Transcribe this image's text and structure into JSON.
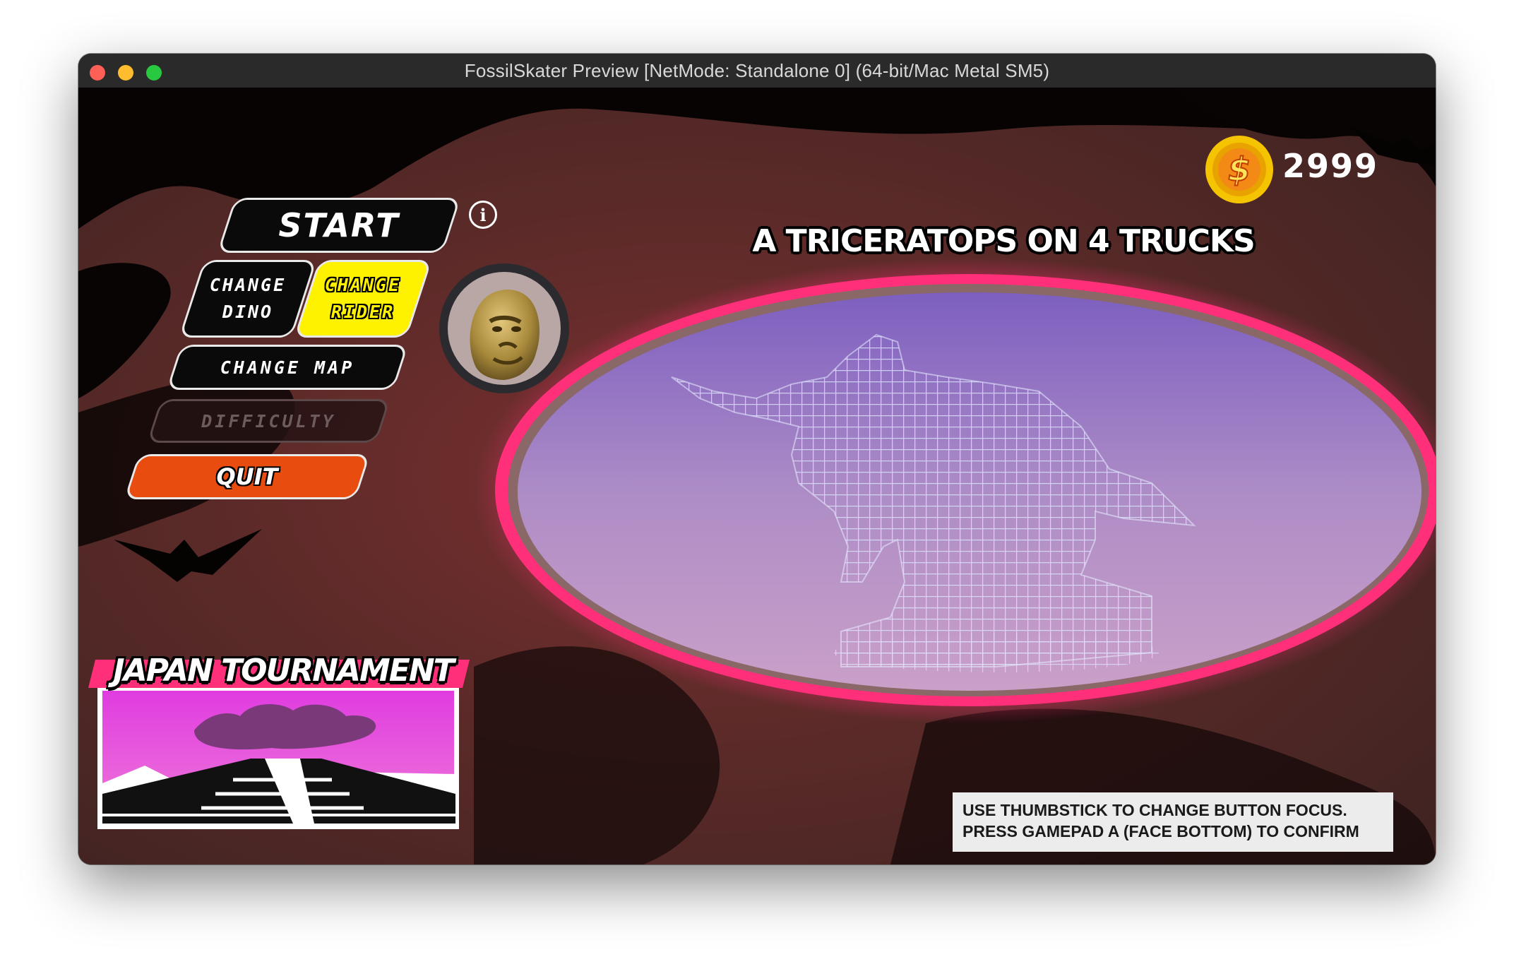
{
  "window": {
    "title": "FossilSkater Preview [NetMode: Standalone 0]  (64-bit/Mac Metal SM5)"
  },
  "hud": {
    "coin_icon": "dollar-coin-icon",
    "coin_count": "2999"
  },
  "menu": {
    "start_label": "START",
    "info_icon": "i",
    "change_dino_label": "CHANGE\nDINO",
    "change_rider_label": "CHANGE\nRIDER",
    "change_map_label": "CHANGE MAP",
    "difficulty_label": "DIFFICULTY",
    "quit_label": "QUIT",
    "focused_item": "CHANGE RIDER",
    "disabled_item": "DIFFICULTY"
  },
  "rider": {
    "avatar_icon": "gorilla-rider-avatar"
  },
  "dino": {
    "name": "A TRICERATOPS ON 4 TRUCKS"
  },
  "tournament": {
    "title": "JAPAN TOURNAMENT"
  },
  "hint": {
    "line1": "USE THUMBSTICK TO CHANGE BUTTON FOCUS.",
    "line2": "PRESS GAMEPAD A (FACE BOTTOM) TO CONFIRM"
  },
  "colors": {
    "accent_pink": "#ff2f7a",
    "focus_yellow": "#fff200",
    "quit_orange": "#e84c0f",
    "coin_gold": "#f5c400"
  }
}
